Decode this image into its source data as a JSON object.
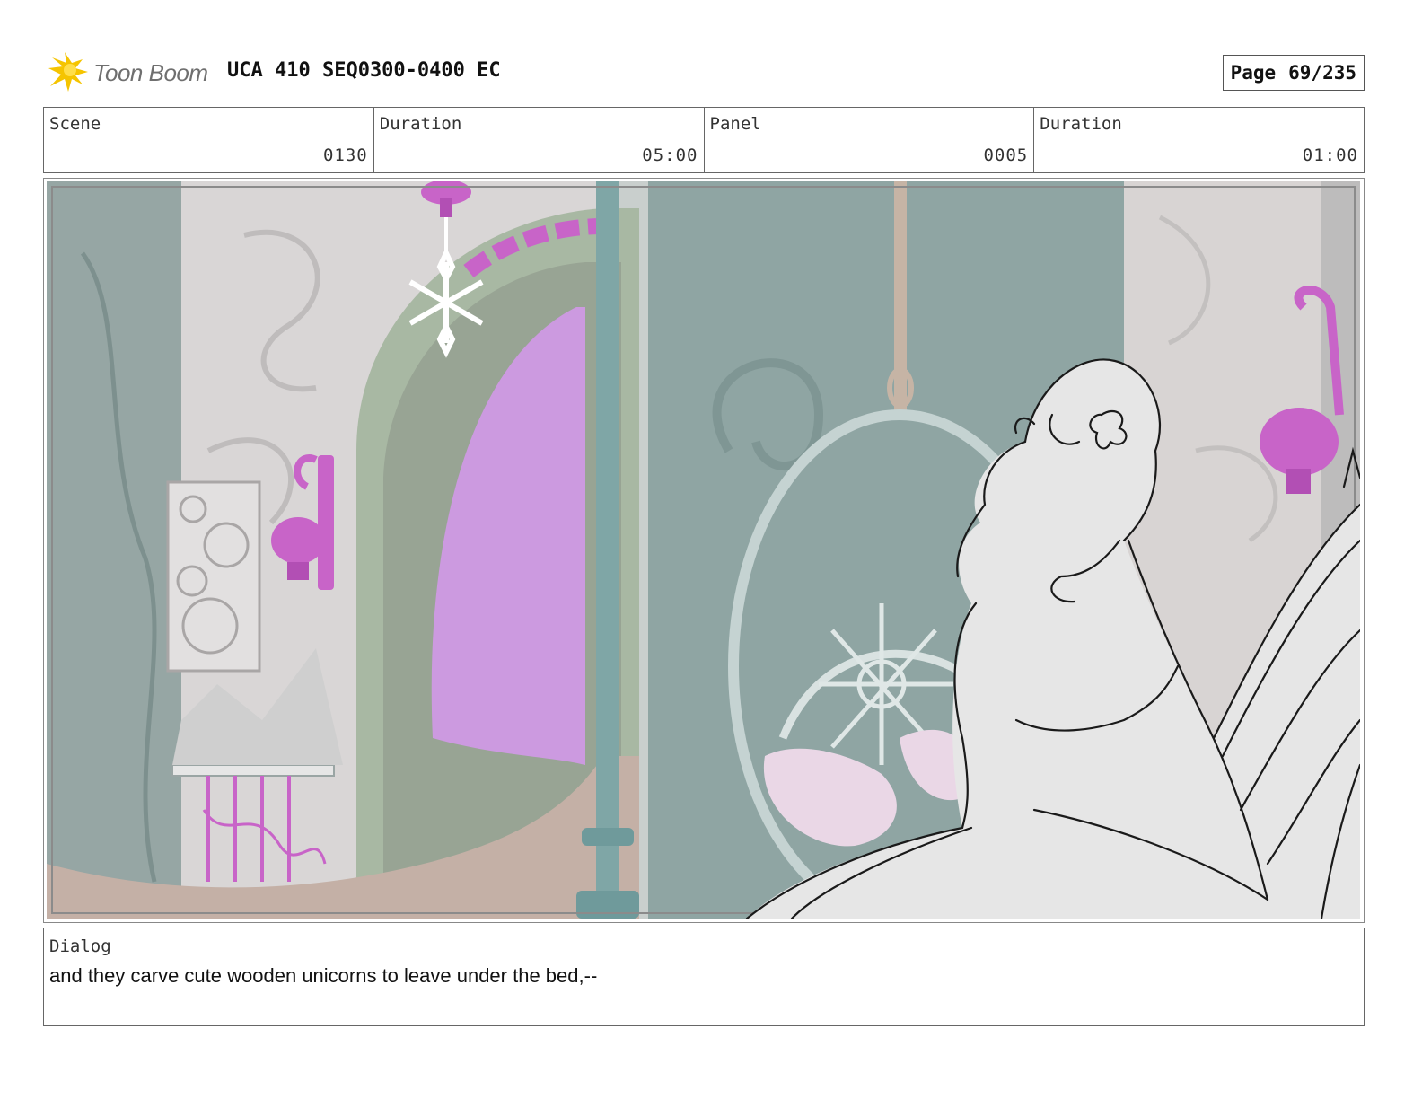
{
  "header": {
    "logo_text": "Toon Boom",
    "title": "UCA 410 SEQ0300-0400 EC",
    "page_label": "Page",
    "page_value": "69/235"
  },
  "info": {
    "scene_label": "Scene",
    "scene_value": "0130",
    "scene_duration_label": "Duration",
    "scene_duration_value": "05:00",
    "panel_label": "Panel",
    "panel_value": "0005",
    "panel_duration_label": "Duration",
    "panel_duration_value": "01:00"
  },
  "dialog": {
    "label": "Dialog",
    "text": "and they carve cute wooden unicorns to leave under the bed,--"
  },
  "colors": {
    "logo_yellow": "#f5c400",
    "wall_teal": "#8fa5a3",
    "magenta_accent": "#c864c8",
    "window_purple": "#cc9ae0"
  }
}
